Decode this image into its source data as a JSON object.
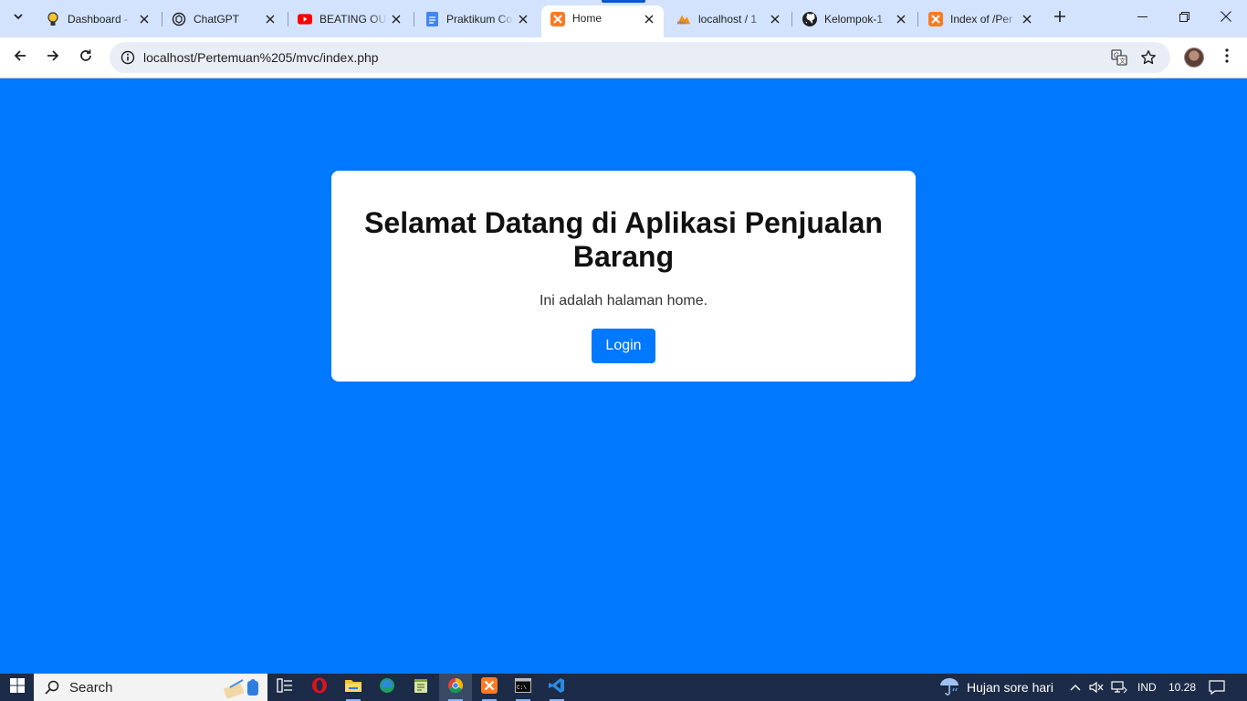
{
  "browser": {
    "tabs": [
      {
        "title": "Dashboard - ",
        "favicon": "lightbulb-icon"
      },
      {
        "title": "ChatGPT",
        "favicon": "chatgpt-icon"
      },
      {
        "title": "BEATING OU",
        "favicon": "youtube-icon"
      },
      {
        "title": "Praktikum Co",
        "favicon": "google-docs-icon"
      },
      {
        "title": "Home",
        "favicon": "xampp-icon",
        "active": true
      },
      {
        "title": "localhost / 1",
        "favicon": "phpmyadmin-icon"
      },
      {
        "title": "Kelompok-1",
        "favicon": "github-icon"
      },
      {
        "title": "Index of /Per",
        "favicon": "xampp-icon"
      }
    ],
    "url": "localhost/Pertemuan%205/mvc/index.php"
  },
  "page": {
    "heading": "Selamat Datang di Aplikasi Penjualan Barang",
    "subtitle": "Ini adalah halaman home.",
    "login_label": "Login",
    "background_color": "#0078ff",
    "button_color": "#0078ff"
  },
  "taskbar": {
    "search_label": "Search",
    "apps": [
      "task-view",
      "opera",
      "file-explorer",
      "edge",
      "notepad",
      "chrome",
      "xampp",
      "terminal",
      "vscode"
    ],
    "weather": "Hujan sore hari",
    "language": "IND",
    "time": "10.28"
  }
}
